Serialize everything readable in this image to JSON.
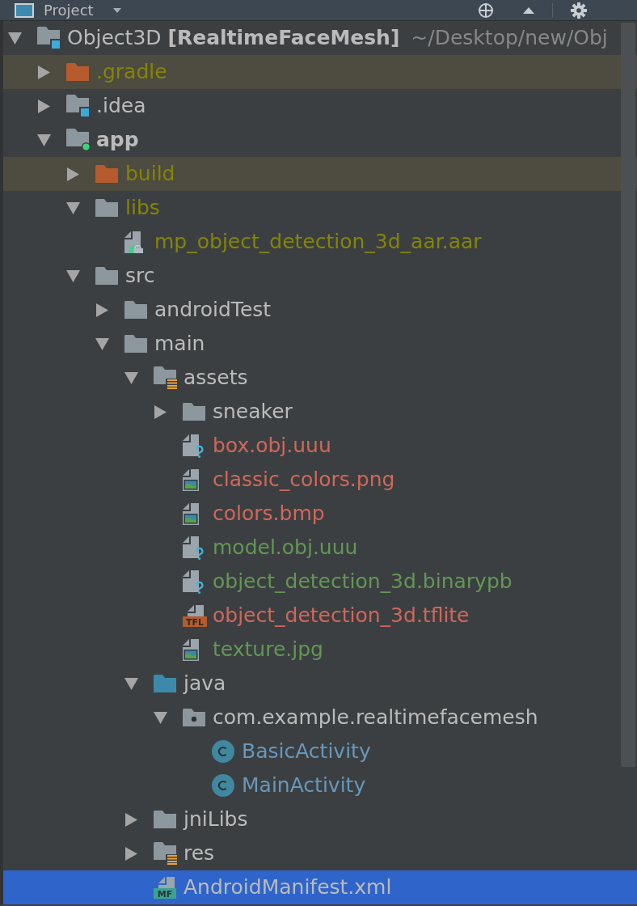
{
  "header": {
    "title": "Project"
  },
  "tree": [
    {
      "kind": "project",
      "label": "Object3D **[RealtimeFaceMesh]**",
      "path": "~/Desktop/new/Obj",
      "color": "#bbbbbb",
      "expanded": true,
      "excluded": false,
      "selected": false,
      "children": [
        {
          "kind": "folder",
          "label": ".gradle",
          "color": "#848504",
          "expanded": false,
          "excluded": true,
          "selected": false
        },
        {
          "kind": "idea-folder",
          "label": ".idea",
          "color": "#bbbbbb",
          "expanded": false,
          "excluded": false,
          "selected": false
        },
        {
          "kind": "module",
          "label": "app",
          "color": "#bbbbbb",
          "expanded": true,
          "excluded": false,
          "selected": false,
          "children": [
            {
              "kind": "folder",
              "label": "build",
              "color": "#848504",
              "expanded": false,
              "excluded": true,
              "selected": false
            },
            {
              "kind": "folder",
              "label": "libs",
              "color": "#848504",
              "expanded": true,
              "excluded": false,
              "selected": false,
              "children": [
                {
                  "kind": "archive",
                  "label": "mp_object_detection_3d_aar.aar",
                  "color": "#848504",
                  "excluded": false,
                  "selected": false
                }
              ]
            },
            {
              "kind": "folder",
              "label": "src",
              "color": "#bbbbbb",
              "expanded": true,
              "excluded": false,
              "selected": false,
              "children": [
                {
                  "kind": "folder",
                  "label": "androidTest",
                  "color": "#bbbbbb",
                  "expanded": false,
                  "excluded": false,
                  "selected": false
                },
                {
                  "kind": "folder",
                  "label": "main",
                  "color": "#bbbbbb",
                  "expanded": true,
                  "excluded": false,
                  "selected": false,
                  "children": [
                    {
                      "kind": "resource-folder",
                      "label": "assets",
                      "color": "#bbbbbb",
                      "expanded": true,
                      "excluded": false,
                      "selected": false,
                      "children": [
                        {
                          "kind": "folder",
                          "label": "sneaker",
                          "color": "#bbbbbb",
                          "expanded": false,
                          "excluded": false,
                          "selected": false
                        },
                        {
                          "kind": "unknown-file",
                          "label": "box.obj.uuu",
                          "color": "#d1675a",
                          "excluded": false,
                          "selected": false
                        },
                        {
                          "kind": "image-file",
                          "label": "classic_colors.png",
                          "color": "#d1675a",
                          "excluded": false,
                          "selected": false
                        },
                        {
                          "kind": "image-file",
                          "label": "colors.bmp",
                          "color": "#d1675a",
                          "excluded": false,
                          "selected": false
                        },
                        {
                          "kind": "unknown-file",
                          "label": "model.obj.uuu",
                          "color": "#629755",
                          "excluded": false,
                          "selected": false
                        },
                        {
                          "kind": "unknown-file",
                          "label": "object_detection_3d.binarypb",
                          "color": "#629755",
                          "excluded": false,
                          "selected": false
                        },
                        {
                          "kind": "tflite-file",
                          "label": "object_detection_3d.tflite",
                          "badge": "TFL",
                          "color": "#d1675a",
                          "excluded": false,
                          "selected": false
                        },
                        {
                          "kind": "image-file",
                          "label": "texture.jpg",
                          "color": "#629755",
                          "excluded": false,
                          "selected": false
                        }
                      ]
                    },
                    {
                      "kind": "source-folder",
                      "label": "java",
                      "color": "#bbbbbb",
                      "expanded": true,
                      "excluded": false,
                      "selected": false,
                      "children": [
                        {
                          "kind": "package",
                          "label": "com.example.realtimefacemesh",
                          "color": "#bbbbbb",
                          "expanded": true,
                          "excluded": false,
                          "selected": false,
                          "children": [
                            {
                              "kind": "class",
                              "label": "BasicActivity",
                              "color": "#6897bb",
                              "excluded": false,
                              "selected": false
                            },
                            {
                              "kind": "class",
                              "label": "MainActivity",
                              "color": "#6897bb",
                              "excluded": false,
                              "selected": false
                            }
                          ]
                        }
                      ]
                    },
                    {
                      "kind": "folder",
                      "label": "jniLibs",
                      "color": "#bbbbbb",
                      "expanded": false,
                      "excluded": false,
                      "selected": false
                    },
                    {
                      "kind": "resource-folder",
                      "label": "res",
                      "color": "#bbbbbb",
                      "expanded": false,
                      "excluded": false,
                      "selected": false
                    },
                    {
                      "kind": "manifest-file",
                      "label": "AndroidManifest.xml",
                      "badge": "MF",
                      "color": "#bbbbbb",
                      "excluded": false,
                      "selected": true
                    }
                  ]
                }
              ]
            }
          ]
        }
      ]
    }
  ]
}
